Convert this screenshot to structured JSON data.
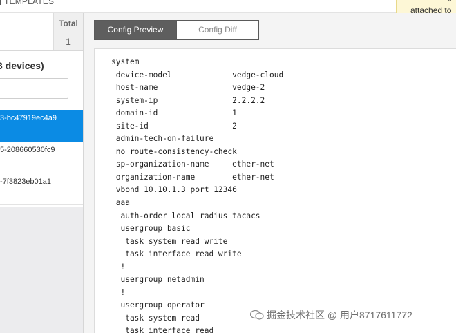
{
  "header": {
    "title": "TEMPLATES"
  },
  "tooltip": {
    "line1": "g",
    "line2": "attached to"
  },
  "left_panel": {
    "total_label": "Total",
    "total_value": "1",
    "devices_heading": "3 devices)",
    "search": {
      "value": "",
      "placeholder": ""
    },
    "devices": [
      {
        "id": "3-bc47919ec4a9",
        "selected": true
      },
      {
        "id": "5-208660530fc9",
        "selected": false
      },
      {
        "id": "-7f3823eb01a1",
        "selected": false
      }
    ]
  },
  "main": {
    "tabs": [
      {
        "label": "Config Preview",
        "active": true
      },
      {
        "label": "Config Diff",
        "active": false
      }
    ],
    "config_lines": [
      "system",
      " device-model             vedge-cloud",
      " host-name                vedge-2",
      " system-ip                2.2.2.2",
      " domain-id                1",
      " site-id                  2",
      " admin-tech-on-failure",
      " no route-consistency-check",
      " sp-organization-name     ether-net",
      " organization-name        ether-net",
      " vbond 10.10.1.3 port 12346",
      " aaa",
      "  auth-order local radius tacacs",
      "  usergroup basic",
      "   task system read write",
      "   task interface read write",
      "  !",
      "  usergroup netadmin",
      "  !",
      "  usergroup operator",
      "   task system read",
      "   task interface read"
    ]
  },
  "watermark": {
    "text": "掘金技术社区 @ 用户8717611772"
  },
  "colors": {
    "accent": "#0b8be4",
    "tab_active": "#5e5e5e",
    "tooltip_bg": "#fdf7d6"
  }
}
